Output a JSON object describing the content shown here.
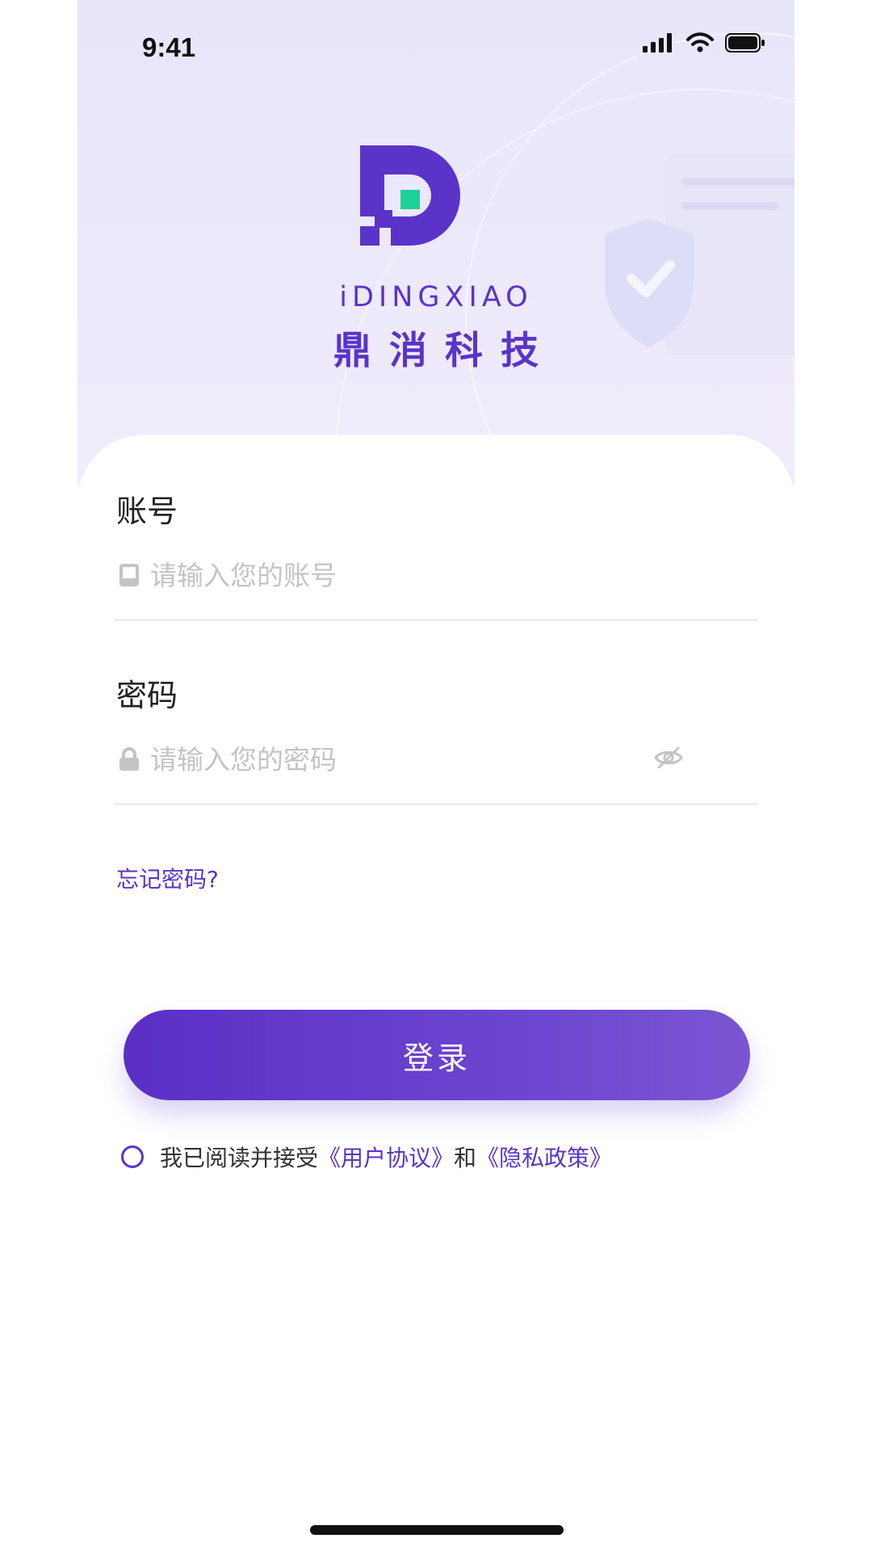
{
  "status": {
    "time": "9:41"
  },
  "brand": {
    "english": "iDINGXIAO",
    "chinese": "鼎消科技",
    "colors": {
      "primary": "#5a34c9",
      "accent": "#1ed09a"
    }
  },
  "account": {
    "label": "账号",
    "placeholder": "请输入您的账号",
    "value": "",
    "icon": "phone-icon"
  },
  "password": {
    "label": "密码",
    "placeholder": "请输入您的密码",
    "value": "",
    "icon": "lock-icon",
    "toggle_icon": "eye-off-icon"
  },
  "forgot_password": "忘记密码?",
  "login_button": "登录",
  "agreement": {
    "prefix": "我已阅读并接受",
    "user_agreement": "《用户协议》",
    "conjunction": "和",
    "privacy_policy": "《隐私政策》",
    "checked": false
  }
}
